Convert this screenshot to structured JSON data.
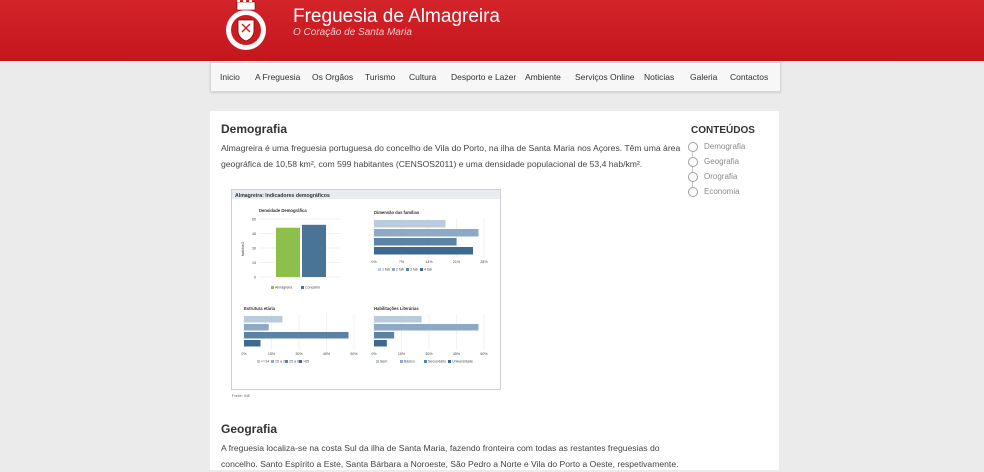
{
  "header": {
    "title": "Freguesia de Almagreira",
    "subtitle": "O Coração de Santa Maria",
    "brand_color": "#cc1a1f"
  },
  "nav": [
    {
      "label": "Inicio"
    },
    {
      "label": "A Freguesia"
    },
    {
      "label": "Os Orgãos"
    },
    {
      "label": "Turismo"
    },
    {
      "label": "Cultura"
    },
    {
      "label": "Desporto e Lazer"
    },
    {
      "label": "Ambiente"
    },
    {
      "label": "Serviços Online"
    },
    {
      "label": "Noticias"
    },
    {
      "label": "Galeria"
    },
    {
      "label": "Contactos"
    }
  ],
  "sections": [
    {
      "title": "Demografia",
      "text": "Almagreira é uma freguesia portuguesa do concelho de Vila do Porto, na ilha de Santa Maria nos Açores. Têm uma área geográfica de 10,58 km², com 599 habitantes (CENSOS2011) e uma densidade populacional de 53,4 hab/km²."
    },
    {
      "title": "Geografia",
      "text": "A freguesia localiza-se na costa Sul da ilha de Santa Maria, fazendo fronteira com todas as restantes freguesias do concelho. Santo Espírito a Este, Santa Bárbara a Noroeste, São Pedro a Norte e Vila do Porto a Oeste, respetivamente."
    }
  ],
  "sidebar": {
    "title": "CONTEÚDOS",
    "items": [
      "Demografia",
      "Geografia",
      "Orografia",
      "Economia"
    ]
  },
  "figure": {
    "title": "Almagreira: Indicadores demográficos",
    "source": "Fonte: INE"
  },
  "chart_data": [
    {
      "type": "bar",
      "title": "Densidade Demográfica",
      "ylabel": "hab/km2",
      "categories": [
        "Almagreira",
        "Concelho"
      ],
      "values": [
        51,
        54
      ],
      "colors": [
        "#8cc04b",
        "#4a7396"
      ],
      "yticks": [
        "60",
        "45",
        "30",
        "15",
        "0"
      ],
      "ylim": [
        0,
        60
      ]
    },
    {
      "type": "bar",
      "orientation": "horizontal",
      "title": "Dimensão das famílias",
      "categories": [
        "1 fab",
        "2 fab",
        "3 fab",
        "4 fab"
      ],
      "values": [
        13,
        19,
        15,
        18
      ],
      "colors": [
        "#b9cbdc",
        "#8ea9c6",
        "#5c83a6",
        "#3e6a8f"
      ],
      "xticks": [
        "0%",
        "7%",
        "14%",
        "21%",
        "28%"
      ],
      "xlim": [
        0,
        20
      ]
    },
    {
      "type": "bar",
      "orientation": "horizontal",
      "title": "Estrutura etária",
      "categories": [
        "<=14",
        "15 a 24",
        "25 a 65",
        ">65"
      ],
      "values": [
        14,
        9,
        38,
        6
      ],
      "colors": [
        "#b9cbdc",
        "#8ea9c6",
        "#5c83a6",
        "#3e6a8f"
      ],
      "xticks": [
        "0%",
        "15%",
        "30%",
        "45%",
        "60%"
      ],
      "xlim": [
        0,
        40
      ]
    },
    {
      "type": "bar",
      "orientation": "horizontal",
      "title": "Habilitações Literárias",
      "categories": [
        "Sem",
        "Básico",
        "Secundário",
        "Universidade"
      ],
      "values": [
        26,
        57,
        11,
        7
      ],
      "colors": [
        "#b9cbdc",
        "#8ea9c6",
        "#5c83a6",
        "#3e6a8f"
      ],
      "xticks": [
        "0%",
        "15%",
        "30%",
        "45%",
        "60%"
      ],
      "xlim": [
        0,
        60
      ]
    }
  ]
}
